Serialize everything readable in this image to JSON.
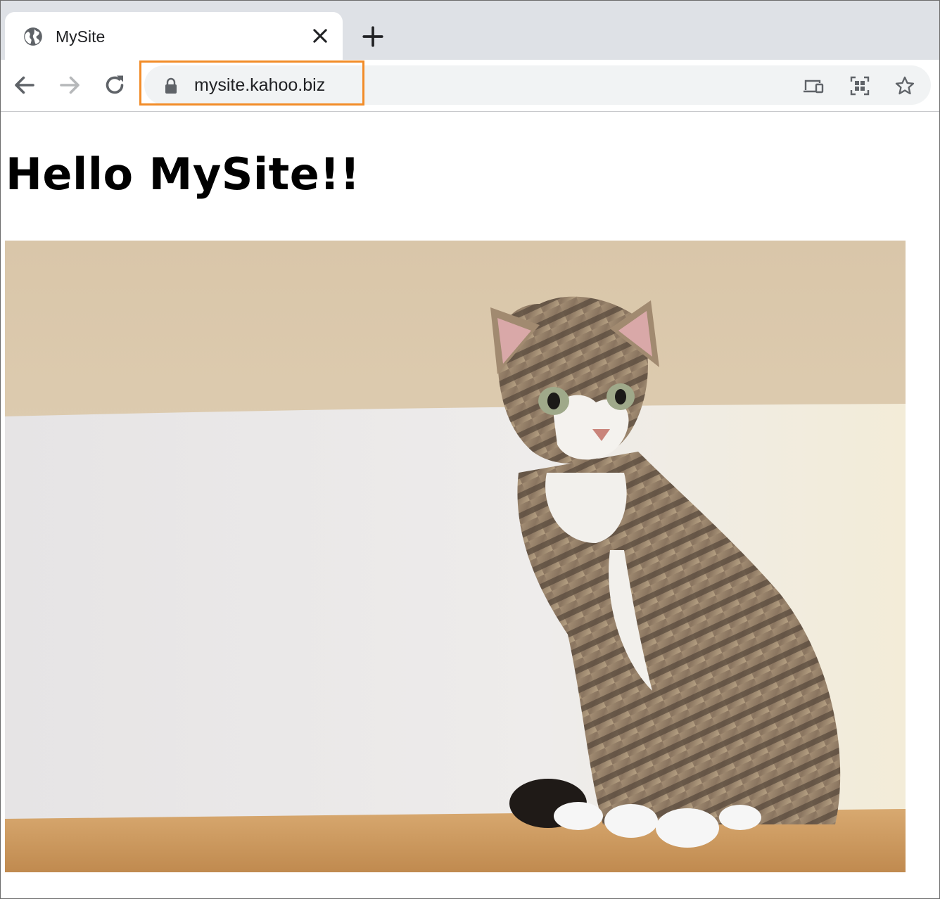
{
  "browser": {
    "tab": {
      "title": "MySite",
      "favicon": "globe-icon"
    },
    "toolbar": {
      "back": "arrow-left-icon",
      "forward": "arrow-right-icon",
      "reload": "reload-icon",
      "url": "mysite.kahoo.biz",
      "secure": "lock-icon",
      "actions": [
        "cast-icon",
        "qr-code-icon",
        "star-icon"
      ]
    },
    "highlight_color": "#f28c28"
  },
  "page": {
    "heading": "Hello MySite!!",
    "image": {
      "subject": "tabby cat sitting on a wooden table"
    }
  }
}
